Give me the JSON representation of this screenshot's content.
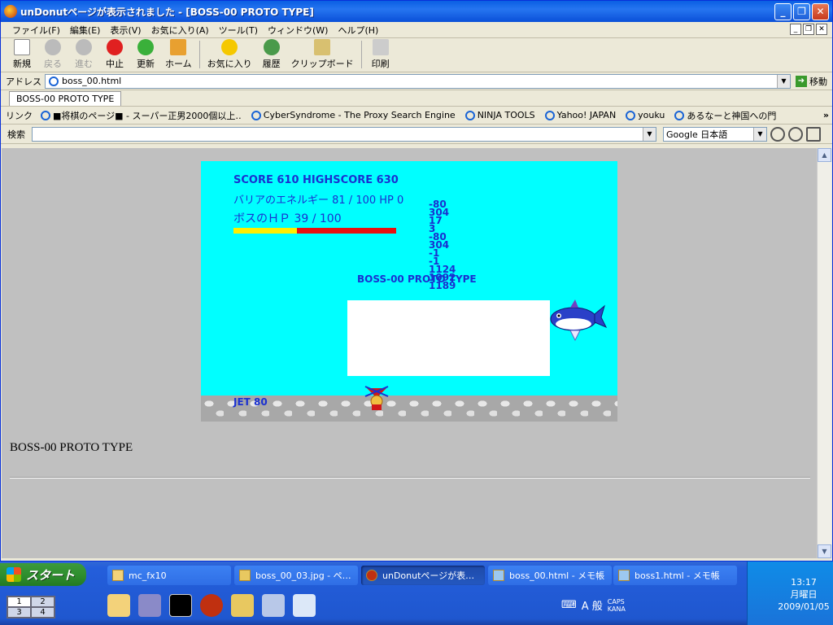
{
  "window": {
    "title": "unDonutページが表示されました - [BOSS-00 PROTO TYPE]"
  },
  "menu": [
    "ファイル(F)",
    "編集(E)",
    "表示(V)",
    "お気に入り(A)",
    "ツール(T)",
    "ウィンドウ(W)",
    "ヘルプ(H)"
  ],
  "toolbar": {
    "new": "新規",
    "back": "戻る",
    "forward": "進む",
    "stop": "中止",
    "refresh": "更新",
    "home": "ホーム",
    "favorites": "お気に入り",
    "history": "履歴",
    "clipboard": "クリップボード",
    "print": "印刷"
  },
  "address": {
    "label": "アドレス",
    "value": "boss_00.html",
    "go": "移動"
  },
  "tabs": [
    "BOSS-00 PROTO TYPE"
  ],
  "links": {
    "label": "リンク",
    "items": [
      "■将棋のページ■ - スーパー正男2000個以上‥",
      "CyberSyndrome - The Proxy Search Engine",
      "NINJA TOOLS",
      "Yahoo! JAPAN",
      "youku",
      "あるなーと神国への門"
    ]
  },
  "search": {
    "label": "検索",
    "value": "",
    "engine": "Google 日本語"
  },
  "game": {
    "score_line": "SCORE 610    HIGHSCORE 630",
    "barrier_line": "バリアのエネルギー  81 / 100    HP 0",
    "boss_line": "ボスのＨＰ  39 / 100",
    "boss_hp": 39,
    "boss_hp_max": 100,
    "debug": [
      "-80",
      "304",
      "17",
      "3",
      "-80",
      "304",
      "-1",
      "-1",
      "1124",
      "1092",
      "1189"
    ],
    "boss_title": "BOSS-00 PROTO TYPE",
    "jet_line": "JET 80"
  },
  "page": {
    "heading": "BOSS-00 PROTO TYPE"
  },
  "taskbar": {
    "start": "スタート",
    "tasks": [
      {
        "label": "mc_fx10",
        "active": false
      },
      {
        "label": "boss_00_03.jpg - ペ…",
        "active": false
      },
      {
        "label": "unDonutページが表…",
        "active": true
      },
      {
        "label": "boss_00.html - メモ帳",
        "active": false
      },
      {
        "label": "boss1.html - メモ帳",
        "active": false
      }
    ],
    "desktops": [
      "1",
      "2",
      "3",
      "4"
    ],
    "ime": "A 般",
    "caps": "CAPS",
    "kana": "KANA",
    "clock": {
      "time": "13:17",
      "day": "月曜日",
      "date": "2009/01/05"
    }
  }
}
